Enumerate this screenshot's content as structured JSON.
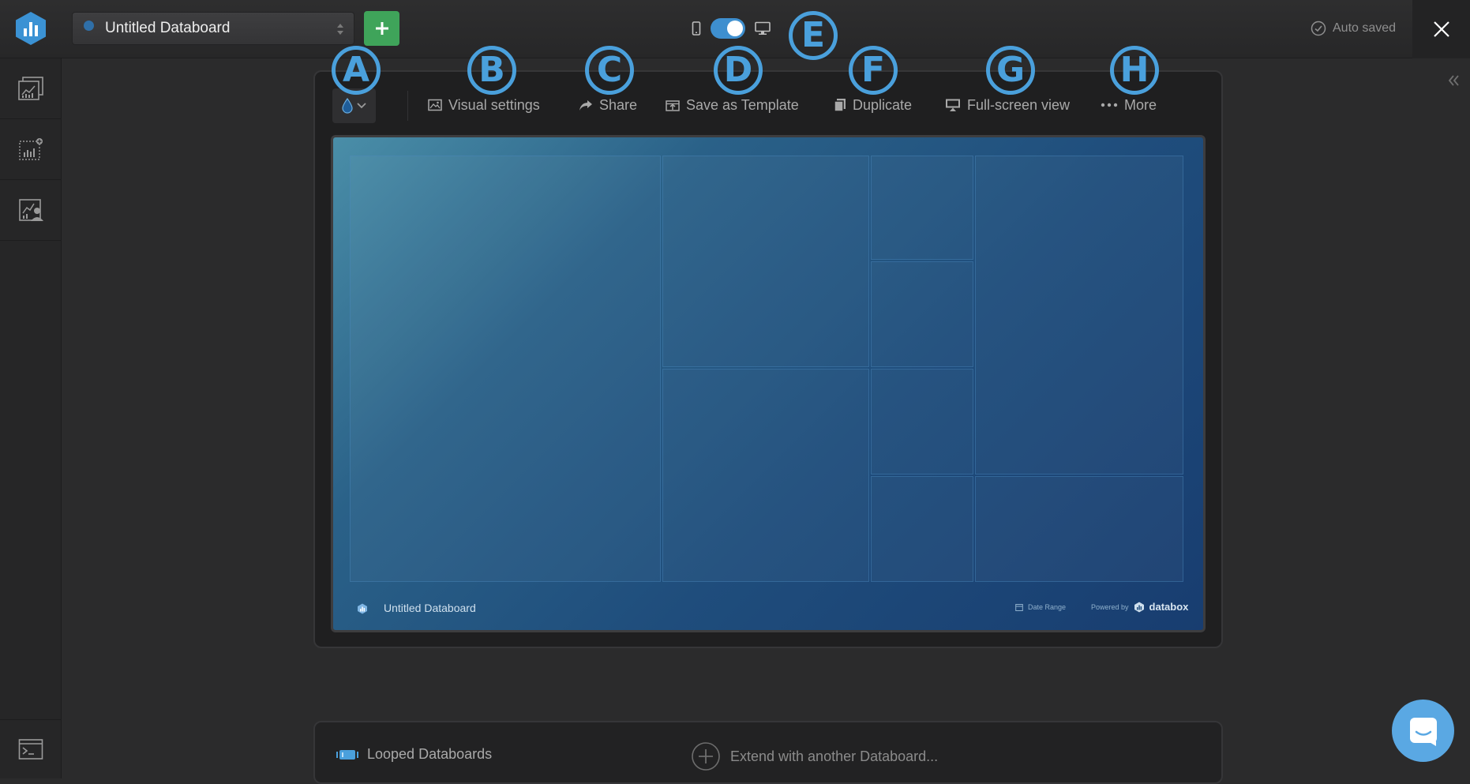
{
  "header": {
    "databoard_name": "Untitled Databoard",
    "add_button_symbol": "+",
    "status": "Auto saved",
    "colors": {
      "accent": "#4aa0dc",
      "add": "#3fa45a"
    }
  },
  "toolbar": {
    "items": [
      {
        "label": "Visual settings",
        "icon": "image-icon"
      },
      {
        "label": "Share",
        "icon": "share-icon"
      },
      {
        "label": "Save as Template",
        "icon": "template-icon"
      },
      {
        "label": "Duplicate",
        "icon": "duplicate-icon"
      },
      {
        "label": "Full-screen view",
        "icon": "monitor-icon"
      },
      {
        "label": "More",
        "icon": "more-dots-icon"
      }
    ]
  },
  "callouts": [
    "A",
    "B",
    "C",
    "D",
    "E",
    "F",
    "G",
    "H"
  ],
  "preview": {
    "footer_title": "Untitled Databoard",
    "date_range": "Date Range",
    "powered_by": "Powered by",
    "brand": "databox"
  },
  "loop": {
    "label": "Looped Databoards",
    "extend": "Extend with another Databoard..."
  }
}
